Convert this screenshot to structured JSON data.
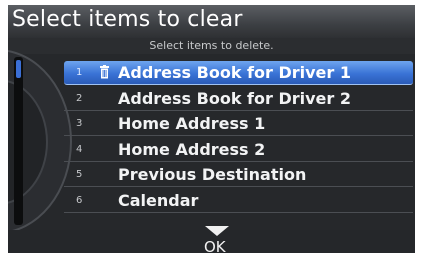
{
  "header": {
    "title": "Select items to clear"
  },
  "subheader": {
    "text": "Select items to delete."
  },
  "list": {
    "items": [
      {
        "num": "1",
        "label": "Address Book for Driver 1",
        "selected": true
      },
      {
        "num": "2",
        "label": "Address Book for Driver 2",
        "selected": false
      },
      {
        "num": "3",
        "label": "Home Address 1",
        "selected": false
      },
      {
        "num": "4",
        "label": "Home Address 2",
        "selected": false
      },
      {
        "num": "5",
        "label": "Previous Destination",
        "selected": false
      },
      {
        "num": "6",
        "label": "Calendar",
        "selected": false
      }
    ]
  },
  "footer": {
    "ok_label": "OK"
  },
  "colors": {
    "selection": "#3a73d6",
    "scroll_thumb": "#3b6fd6",
    "panel_bg": "#1f2124"
  },
  "icons": {
    "selected_item_icon": "trash-can-icon",
    "more_indicator": "down-arrow-icon"
  }
}
